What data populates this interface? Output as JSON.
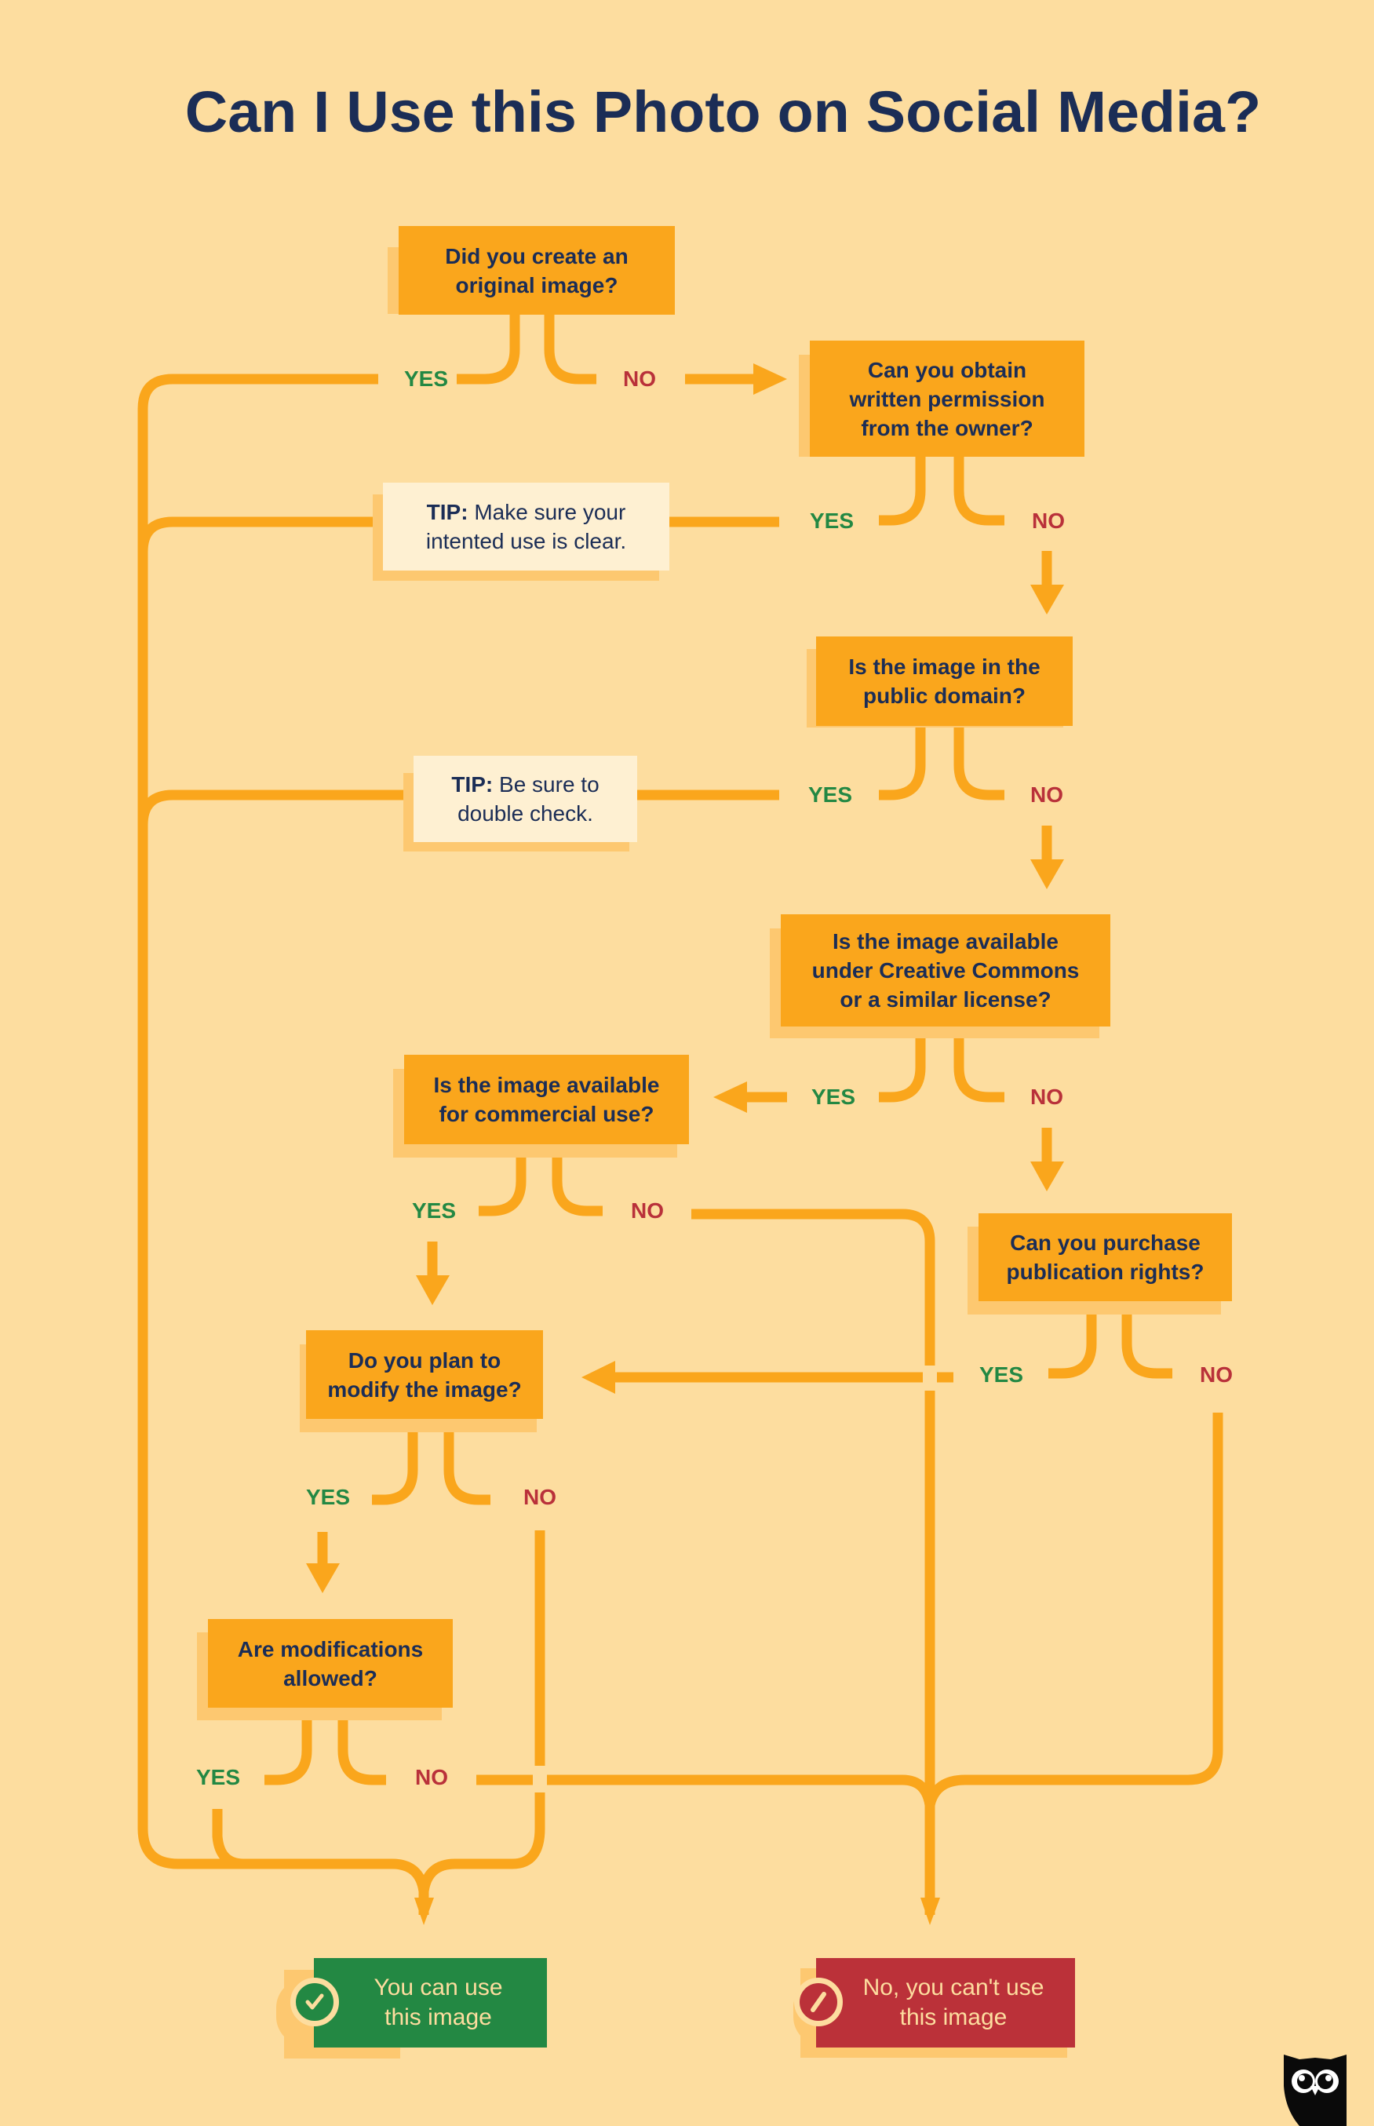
{
  "title": "Can I Use this Photo on Social Media?",
  "colors": {
    "background": "#FDDD9F",
    "connector": "#FAA61C",
    "box_fill": "#FAA61C",
    "box_shadow": "#FDC870",
    "tip_fill": "#FEF0D2",
    "text_dark": "#1B2D56",
    "yes": "#238843",
    "no": "#B9313A",
    "result_yes": "#238843",
    "result_no": "#BB3139"
  },
  "questions": [
    {
      "id": "q1",
      "text_lines": [
        "Did you create an",
        "original image?"
      ]
    },
    {
      "id": "q2",
      "text_lines": [
        "Can you obtain",
        "written permission",
        "from the owner?"
      ]
    },
    {
      "id": "q3",
      "text_lines": [
        "Is the image in the",
        "public domain?"
      ]
    },
    {
      "id": "q4",
      "text_lines": [
        "Is the image available",
        "under Creative Commons",
        "or a similar license?"
      ]
    },
    {
      "id": "q5",
      "text_lines": [
        "Is the image available",
        "for commercial use?"
      ]
    },
    {
      "id": "q6",
      "text_lines": [
        "Can you purchase",
        "publication rights?"
      ]
    },
    {
      "id": "q7",
      "text_lines": [
        "Do you plan to",
        "modify the image?"
      ]
    },
    {
      "id": "q8",
      "text_lines": [
        "Are modifications",
        "allowed?"
      ]
    }
  ],
  "tips": [
    {
      "id": "tip1",
      "label": "TIP:",
      "text_lines": [
        " Make sure your",
        "intented use is clear."
      ]
    },
    {
      "id": "tip2",
      "label": "TIP:",
      "text_lines": [
        " Be sure to",
        "double check."
      ]
    }
  ],
  "answers": {
    "yes": "YES",
    "no": "NO"
  },
  "results": {
    "yes": {
      "text_lines": [
        "You can use",
        "this image"
      ],
      "icon": "check-circle-icon"
    },
    "no": {
      "text_lines": [
        "No, you can't use",
        "this image"
      ],
      "icon": "prohibited-icon"
    }
  },
  "logo": {
    "icon": "owl-logo-icon"
  },
  "flow": [
    {
      "from": "q1",
      "answer": "yes",
      "to": "result-yes"
    },
    {
      "from": "q1",
      "answer": "no",
      "to": "q2"
    },
    {
      "from": "q2",
      "answer": "yes",
      "to": "result-yes",
      "via": "tip1"
    },
    {
      "from": "q2",
      "answer": "no",
      "to": "q3"
    },
    {
      "from": "q3",
      "answer": "yes",
      "to": "result-yes",
      "via": "tip2"
    },
    {
      "from": "q3",
      "answer": "no",
      "to": "q4"
    },
    {
      "from": "q4",
      "answer": "yes",
      "to": "q5"
    },
    {
      "from": "q4",
      "answer": "no",
      "to": "q6"
    },
    {
      "from": "q5",
      "answer": "yes",
      "to": "q7"
    },
    {
      "from": "q5",
      "answer": "no",
      "to": "result-no"
    },
    {
      "from": "q6",
      "answer": "yes",
      "to": "q7"
    },
    {
      "from": "q6",
      "answer": "no",
      "to": "result-no"
    },
    {
      "from": "q7",
      "answer": "yes",
      "to": "q8"
    },
    {
      "from": "q7",
      "answer": "no",
      "to": "result-yes"
    },
    {
      "from": "q8",
      "answer": "yes",
      "to": "result-yes"
    },
    {
      "from": "q8",
      "answer": "no",
      "to": "result-no"
    }
  ]
}
